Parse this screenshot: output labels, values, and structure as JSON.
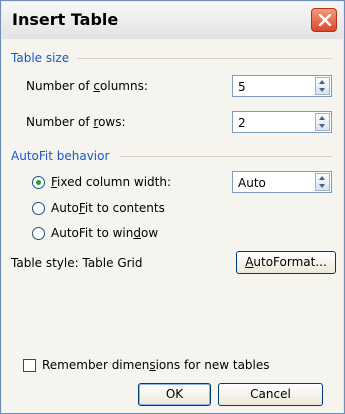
{
  "dialog": {
    "title": "Insert Table",
    "close_label": "✕"
  },
  "table_size": {
    "group_label": "Table size",
    "columns_label_pre": "Number of ",
    "columns_label_key": "c",
    "columns_label_post": "olumns:",
    "columns_value": "5",
    "rows_label_pre": "Number of ",
    "rows_label_key": "r",
    "rows_label_post": "ows:",
    "rows_value": "2"
  },
  "autofit": {
    "group_label": "AutoFit behavior",
    "fixed_label_pre": "",
    "fixed_label_key": "F",
    "fixed_label_post": "ixed column width:",
    "fixed_value": "Auto",
    "contents_label_pre": "Auto",
    "contents_label_key": "F",
    "contents_label_post": "it to contents",
    "window_label_pre": "AutoFit to win",
    "window_label_key": "d",
    "window_label_post": "ow",
    "selected": "fixed"
  },
  "style": {
    "label": "Table style: Table Grid",
    "autoformat_pre": "",
    "autoformat_key": "A",
    "autoformat_post": "utoFormat..."
  },
  "remember": {
    "label_pre": "Remember dimen",
    "label_key": "s",
    "label_post": "ions for new tables",
    "checked": false
  },
  "buttons": {
    "ok": "OK",
    "cancel": "Cancel"
  },
  "colors": {
    "group_label": "#1c58c8",
    "close_button": "#d9482d"
  }
}
